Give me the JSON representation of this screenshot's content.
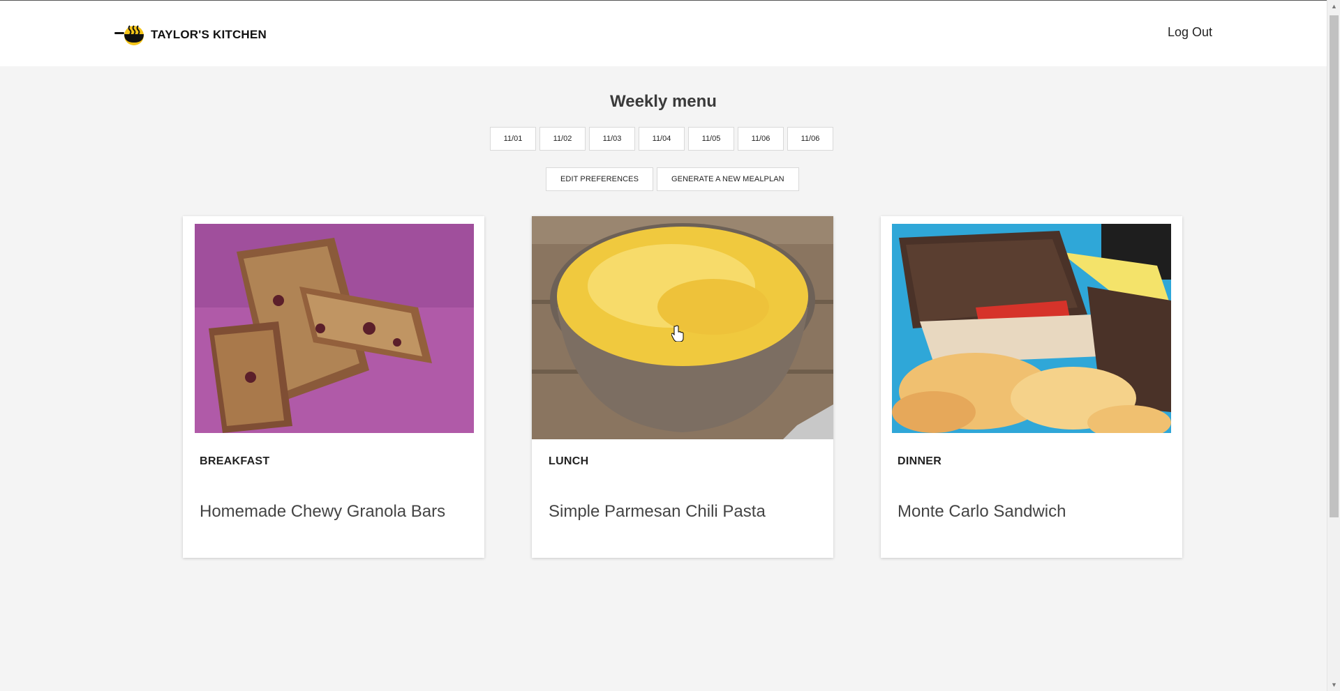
{
  "header": {
    "brand": "TAYLOR'S KITCHEN",
    "logout_label": "Log Out"
  },
  "main": {
    "title": "Weekly menu",
    "dates": [
      "11/01",
      "11/02",
      "11/03",
      "11/04",
      "11/05",
      "11/06",
      "11/06"
    ],
    "actions": {
      "edit_preferences": "EDIT PREFERENCES",
      "generate": "GENERATE A NEW MEALPLAN"
    },
    "meals": [
      {
        "meal": "BREAKFAST",
        "name": "Homemade Chewy Granola Bars",
        "image": "granola-bars-photo"
      },
      {
        "meal": "LUNCH",
        "name": "Simple Parmesan Chili Pasta",
        "image": "parmesan-pasta-photo"
      },
      {
        "meal": "DINNER",
        "name": "Monte Carlo Sandwich",
        "image": "monte-carlo-sandwich-photo"
      }
    ]
  },
  "colors": {
    "background": "#f4f4f4",
    "accent_logo": "#f5c518"
  }
}
